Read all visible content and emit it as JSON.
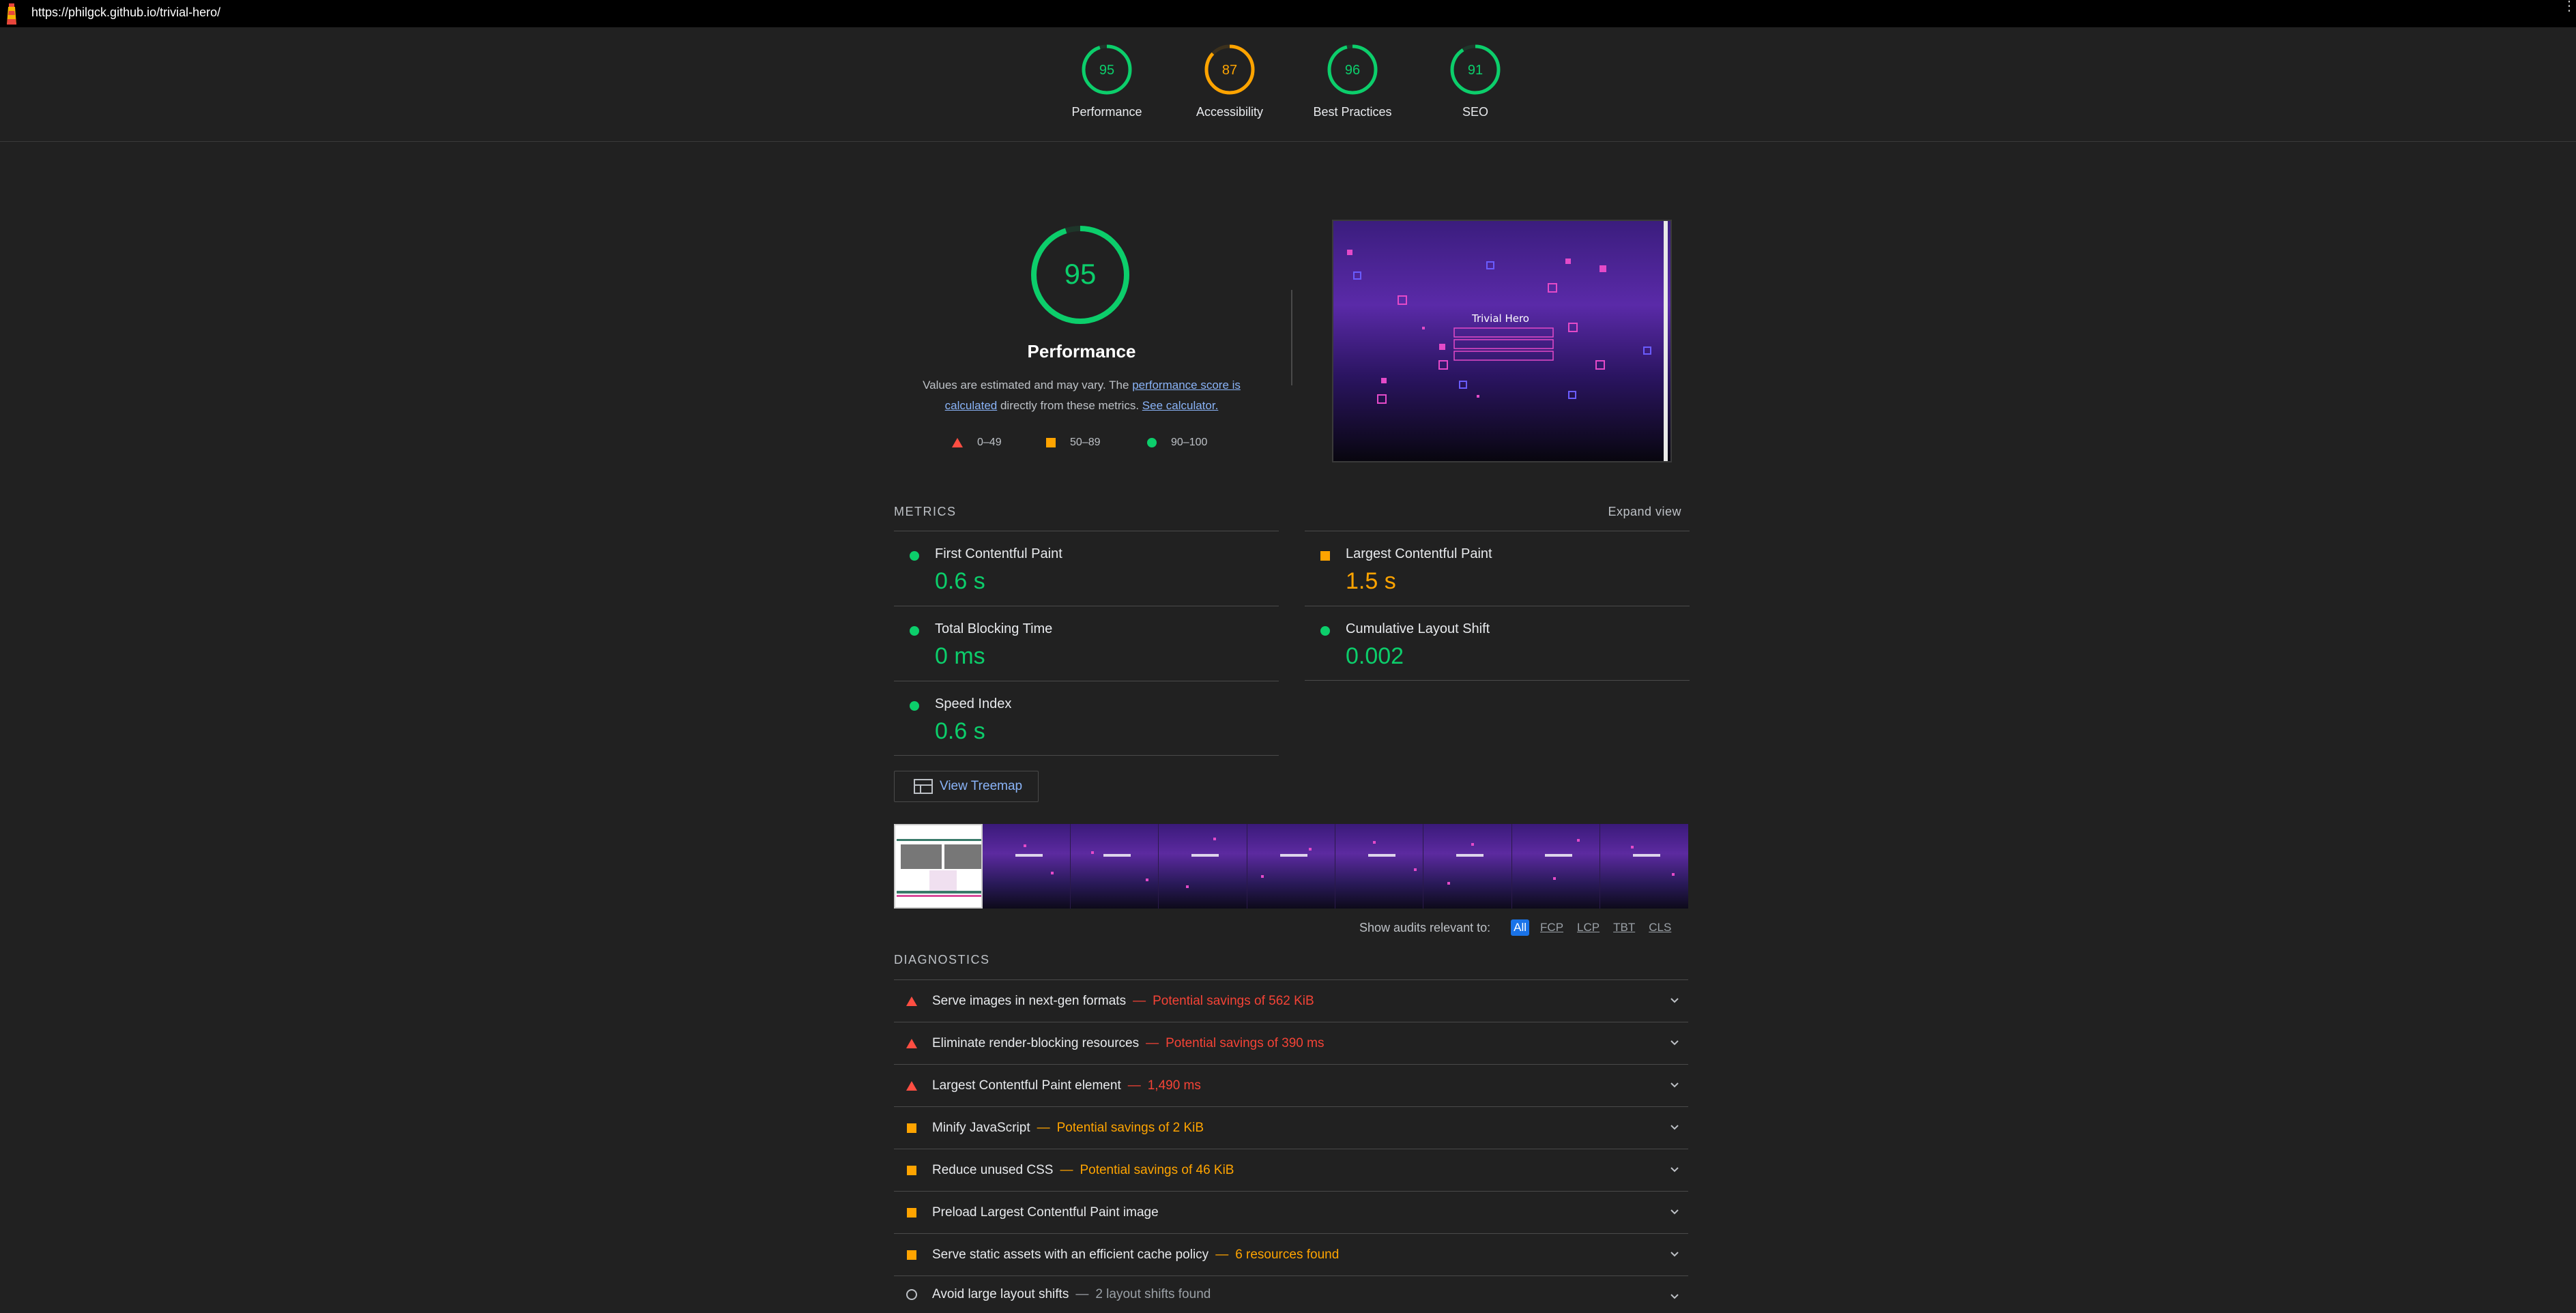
{
  "url_bar": {
    "url": "https://philgck.github.io/trivial-hero/"
  },
  "gauges": [
    {
      "label": "Performance",
      "score": "95",
      "color": "#0cce6b",
      "fraction": 0.95
    },
    {
      "label": "Accessibility",
      "score": "87",
      "color": "#ffa400",
      "fraction": 0.87
    },
    {
      "label": "Best Practices",
      "score": "96",
      "color": "#0cce6b",
      "fraction": 0.96
    },
    {
      "label": "SEO",
      "score": "91",
      "color": "#0cce6b",
      "fraction": 0.91
    }
  ],
  "performance": {
    "score": "95",
    "score_fraction": 0.95,
    "title": "Performance",
    "desc_prefix": "Values are estimated and may vary. The ",
    "desc_link1": "performance score is calculated",
    "desc_middle": " directly from these metrics. ",
    "desc_link2": "See calculator.",
    "legend": [
      {
        "range": "0–49",
        "shape": "triangle",
        "color": "#ff4e42"
      },
      {
        "range": "50–89",
        "shape": "square",
        "color": "#ffa400"
      },
      {
        "range": "90–100",
        "shape": "circle",
        "color": "#0cce6b"
      }
    ]
  },
  "screenshot": {
    "title": "Trivial Hero"
  },
  "metrics": {
    "section_title": "METRICS",
    "expand_label": "Expand view",
    "items": [
      {
        "name": "First Contentful Paint",
        "value": "0.6 s",
        "status": "pass"
      },
      {
        "name": "Largest Contentful Paint",
        "value": "1.5 s",
        "status": "average"
      },
      {
        "name": "Total Blocking Time",
        "value": "0 ms",
        "status": "pass"
      },
      {
        "name": "Cumulative Layout Shift",
        "value": "0.002",
        "status": "pass"
      },
      {
        "name": "Speed Index",
        "value": "0.6 s",
        "status": "pass"
      }
    ]
  },
  "treemap": {
    "label": "View Treemap"
  },
  "filter": {
    "label": "Show audits relevant to:",
    "chips": [
      "All",
      "FCP",
      "LCP",
      "TBT",
      "CLS"
    ]
  },
  "diagnostics": {
    "section_title": "DIAGNOSTICS",
    "items": [
      {
        "title": "Serve images in next-gen formats",
        "detail": "Potential savings of 562 KiB",
        "status": "fail"
      },
      {
        "title": "Eliminate render-blocking resources",
        "detail": "Potential savings of 390 ms",
        "status": "fail"
      },
      {
        "title": "Largest Contentful Paint element",
        "detail": "1,490 ms",
        "status": "fail"
      },
      {
        "title": "Minify JavaScript",
        "detail": "Potential savings of 2 KiB",
        "status": "average"
      },
      {
        "title": "Reduce unused CSS",
        "detail": "Potential savings of 46 KiB",
        "status": "average"
      },
      {
        "title": "Preload Largest Contentful Paint image",
        "detail": "",
        "status": "average"
      },
      {
        "title": "Serve static assets with an efficient cache policy",
        "detail": "6 resources found",
        "status": "average"
      },
      {
        "title": "Avoid large layout shifts",
        "detail": "2 layout shifts found",
        "status": "info"
      }
    ]
  }
}
